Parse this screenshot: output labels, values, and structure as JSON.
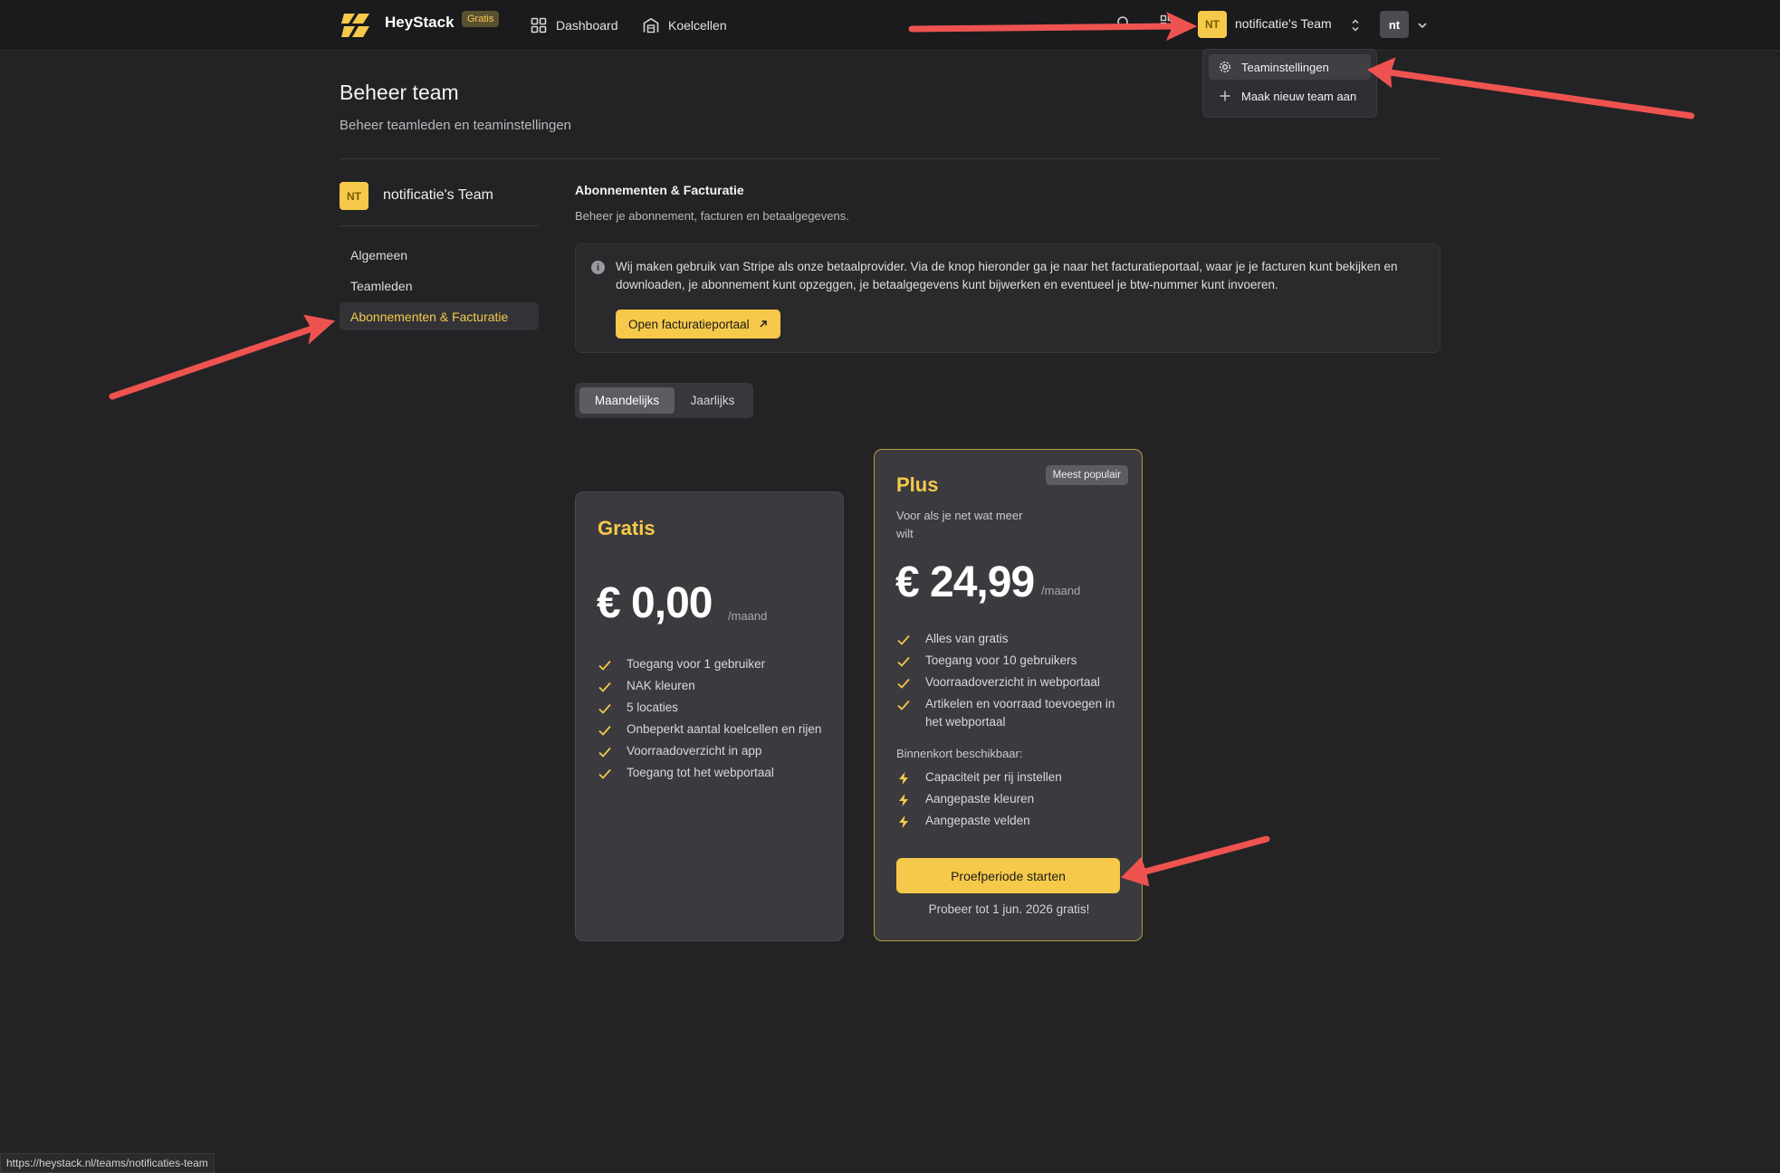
{
  "nav": {
    "brand": "HeyStack",
    "plan_badge": "Gratis",
    "links": [
      {
        "label": "Dashboard",
        "icon": "grid-icon"
      },
      {
        "label": "Koelcellen",
        "icon": "warehouse-icon"
      }
    ],
    "team_initials": "NT",
    "team_name": "notificatie's Team",
    "user_initials": "nt"
  },
  "dropdown": {
    "items": [
      {
        "label": "Teaminstellingen",
        "icon": "gear-icon"
      },
      {
        "label": "Maak nieuw team aan",
        "icon": "plus-icon"
      }
    ]
  },
  "header": {
    "title": "Beheer team",
    "subtitle": "Beheer teamleden en teaminstellingen"
  },
  "sidebar": {
    "team_initials": "NT",
    "team_name": "notificatie's Team",
    "items": [
      {
        "label": "Algemeen"
      },
      {
        "label": "Teamleden"
      },
      {
        "label": "Abonnementen & Facturatie"
      }
    ]
  },
  "billing": {
    "title": "Abonnementen & Facturatie",
    "subtitle": "Beheer je abonnement, facturen en betaalgegevens.",
    "info_text": "Wij maken gebruik van Stripe als onze betaalprovider. Via de knop hieronder ga je naar het facturatieportaal, waar je je facturen kunt bekijken en downloaden, je abonnement kunt opzeggen, je betaalgegevens kunt bijwerken en eventueel je btw-nummer kunt invoeren.",
    "portal_button": "Open facturatieportaal"
  },
  "toggle": {
    "monthly": "Maandelijks",
    "yearly": "Jaarlijks"
  },
  "plans": {
    "free": {
      "name": "Gratis",
      "price": "€ 0,00",
      "unit": "/maand",
      "features": [
        "Toegang voor 1 gebruiker",
        "NAK kleuren",
        "5 locaties",
        "Onbeperkt aantal koelcellen en rijen",
        "Voorraadoverzicht in app",
        "Toegang tot het webportaal"
      ]
    },
    "plus": {
      "name": "Plus",
      "badge": "Meest populair",
      "description": "Voor als je net wat meer wilt",
      "price": "€ 24,99",
      "unit": "/maand",
      "features": [
        "Alles van gratis",
        "Toegang voor 10 gebruikers",
        "Voorraadoverzicht in webportaal",
        "Artikelen en voorraad toevoegen in het webportaal"
      ],
      "coming_title": "Binnenkort beschikbaar:",
      "coming": [
        "Capaciteit per rij instellen",
        "Aangepaste kleuren",
        "Aangepaste velden"
      ],
      "cta": "Proefperiode starten",
      "trial_note": "Probeer tot 1 jun. 2026 gratis!"
    }
  },
  "status_url": "https://heystack.nl/teams/notificaties-team",
  "colors": {
    "accent": "#f6c94a",
    "background": "#232325",
    "annotation_arrow": "#ef5350"
  }
}
